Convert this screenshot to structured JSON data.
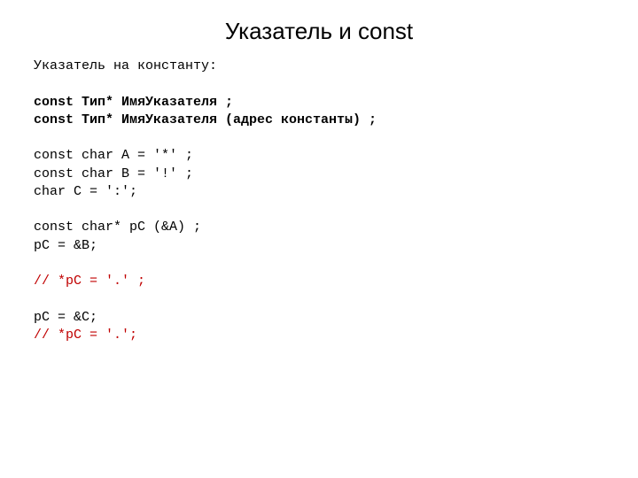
{
  "title": "Указатель и const",
  "lines": {
    "l1": "Указатель на константу:",
    "l2": "",
    "l3": "const Тип* ИмяУказателя ;",
    "l4": "const Тип* ИмяУказателя (адрес константы) ;",
    "l5": "",
    "l6": "const char A = '*' ;",
    "l7": "const char B = '!' ;",
    "l8": "char C = ':';",
    "l9": "",
    "l10": "const char* pC (&A) ;",
    "l11": "pC = &B;",
    "l12": "",
    "l13": "// *pC = '.' ;",
    "l14": "",
    "l15": "pC = &C;",
    "l16": "// *pC = '.';"
  }
}
